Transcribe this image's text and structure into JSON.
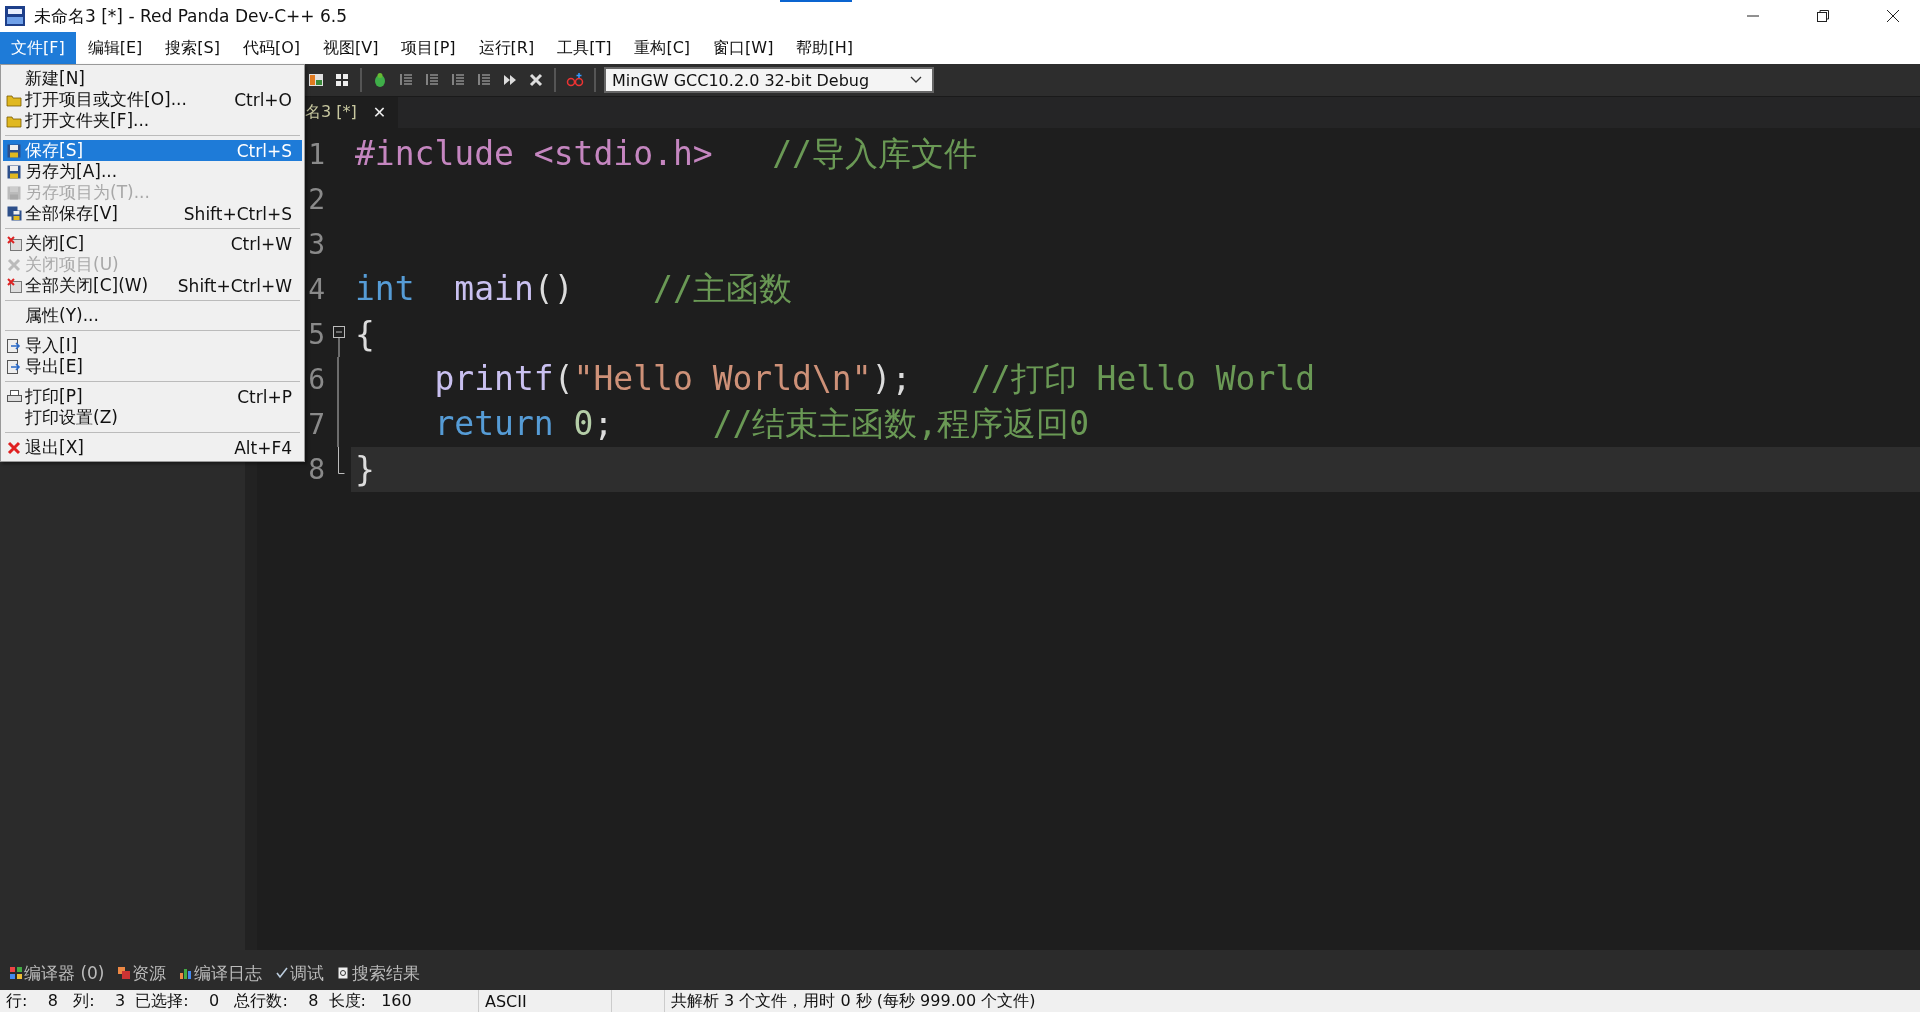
{
  "window": {
    "title": "未命名3 [*] - Red Panda Dev-C++ 6.5"
  },
  "menubar": [
    {
      "label": "文件[F]",
      "selected": true
    },
    {
      "label": "编辑[E]",
      "selected": false
    },
    {
      "label": "搜索[S]",
      "selected": false
    },
    {
      "label": "代码[O]",
      "selected": false
    },
    {
      "label": "视图[V]",
      "selected": false
    },
    {
      "label": "项目[P]",
      "selected": false
    },
    {
      "label": "运行[R]",
      "selected": false
    },
    {
      "label": "工具[T]",
      "selected": false
    },
    {
      "label": "重构[C]",
      "selected": false
    },
    {
      "label": "窗口[W]",
      "selected": false
    },
    {
      "label": "帮助[H]",
      "selected": false
    }
  ],
  "file_menu": {
    "groups": [
      [
        {
          "kind": "plain",
          "label": "新建[N]",
          "disabled": false,
          "selected": false
        },
        {
          "kind": "folder",
          "label": "打开项目或文件[O]...",
          "shortcut": "Ctrl+O",
          "disabled": false,
          "selected": false
        },
        {
          "kind": "folder",
          "label": "打开文件夹[F]...",
          "disabled": false,
          "selected": false
        }
      ],
      [
        {
          "kind": "disk",
          "label": "保存[S]",
          "shortcut": "Ctrl+S",
          "disabled": false,
          "selected": true
        },
        {
          "kind": "disk",
          "label": "另存为[A]...",
          "disabled": false,
          "selected": false
        },
        {
          "kind": "disk",
          "label": "另存项目为(T)...",
          "disabled": true,
          "selected": false
        },
        {
          "kind": "disks",
          "label": "全部保存[V]",
          "shortcut": "Shift+Ctrl+S",
          "disabled": false,
          "selected": false
        }
      ],
      [
        {
          "kind": "close",
          "label": "关闭[C]",
          "shortcut": "Ctrl+W",
          "disabled": false,
          "selected": false
        },
        {
          "kind": "cross",
          "label": "关闭项目(U)",
          "disabled": true,
          "selected": false
        },
        {
          "kind": "close",
          "label": "全部关闭[C](W)",
          "shortcut": "Shift+Ctrl+W",
          "disabled": false,
          "selected": false
        }
      ],
      [
        {
          "kind": "plain",
          "label": "属性(Y)...",
          "disabled": false,
          "selected": false
        }
      ],
      [
        {
          "kind": "import",
          "label": "导入[I]",
          "disabled": false,
          "selected": false
        },
        {
          "kind": "import",
          "label": "导出[E]",
          "disabled": false,
          "selected": false
        }
      ],
      [
        {
          "kind": "print",
          "label": "打印[P]",
          "shortcut": "Ctrl+P",
          "disabled": false,
          "selected": false
        },
        {
          "kind": "plain",
          "label": "打印设置(Z)",
          "disabled": false,
          "selected": false
        }
      ],
      [
        {
          "kind": "cross",
          "label": "退出[X]",
          "shortcut": "Alt+F4",
          "disabled": false,
          "selected": false
        }
      ]
    ]
  },
  "toolbar": {
    "compiler": "MinGW GCC10.2.0 32-bit Debug"
  },
  "editor": {
    "tab": {
      "label": "名3 [*]",
      "close": "✕"
    },
    "lines": [
      {
        "number": "1",
        "current": false,
        "kind": "plain",
        "tokens": [
          {
            "kind": "preproc",
            "text": "#include <stdio.h>"
          },
          {
            "kind": "comment",
            "text": "   //导入库文件"
          }
        ]
      },
      {
        "number": "2",
        "current": false,
        "kind": "plain"
      },
      {
        "number": "3",
        "current": false,
        "kind": "plain"
      },
      {
        "number": "4",
        "current": false,
        "kind": "plain",
        "tokens": [
          {
            "kind": "keyword",
            "text": "int"
          },
          {
            "kind": "function",
            "text": "  main"
          },
          {
            "kind": "plain",
            "text": "()"
          },
          {
            "kind": "comment",
            "text": "    //主函数"
          }
        ]
      },
      {
        "number": "5",
        "current": false,
        "kind": "fold_start",
        "tokens": [
          {
            "kind": "plain",
            "text": "{"
          }
        ]
      },
      {
        "number": "6",
        "current": false,
        "kind": "fold_body",
        "tokens": [
          {
            "kind": "function",
            "text": "    printf"
          },
          {
            "kind": "plain",
            "text": "("
          },
          {
            "kind": "string",
            "text": "\"Hello World\\n\""
          },
          {
            "kind": "plain",
            "text": ");"
          },
          {
            "kind": "comment",
            "text": "   //打印 Hello World"
          }
        ]
      },
      {
        "number": "7",
        "current": false,
        "kind": "fold_body",
        "tokens": [
          {
            "kind": "keyword",
            "text": "    return"
          },
          {
            "kind": "number",
            "text": " 0"
          },
          {
            "kind": "plain",
            "text": ";"
          },
          {
            "kind": "comment",
            "text": "     //结束主函数,程序返回0"
          }
        ]
      },
      {
        "number": "8",
        "current": true,
        "kind": "fold_end",
        "tokens": [
          {
            "kind": "plain",
            "text": "}"
          }
        ]
      }
    ]
  },
  "bottom_tabs": [
    {
      "kind": "compiler",
      "label": "编译器 (0)"
    },
    {
      "kind": "resource",
      "label": "资源"
    },
    {
      "kind": "log",
      "label": "编译日志"
    },
    {
      "kind": "debug",
      "label": "调试"
    },
    {
      "kind": "search",
      "label": "搜索结果"
    }
  ],
  "status_bar": {
    "position": "行:    8   列:    3  已选择:    0   总行数:    8  长度:   160",
    "encoding": "ASCII",
    "message": "共解析 3 个文件，用时 0 秒 (每秒 999.00 个文件)"
  }
}
